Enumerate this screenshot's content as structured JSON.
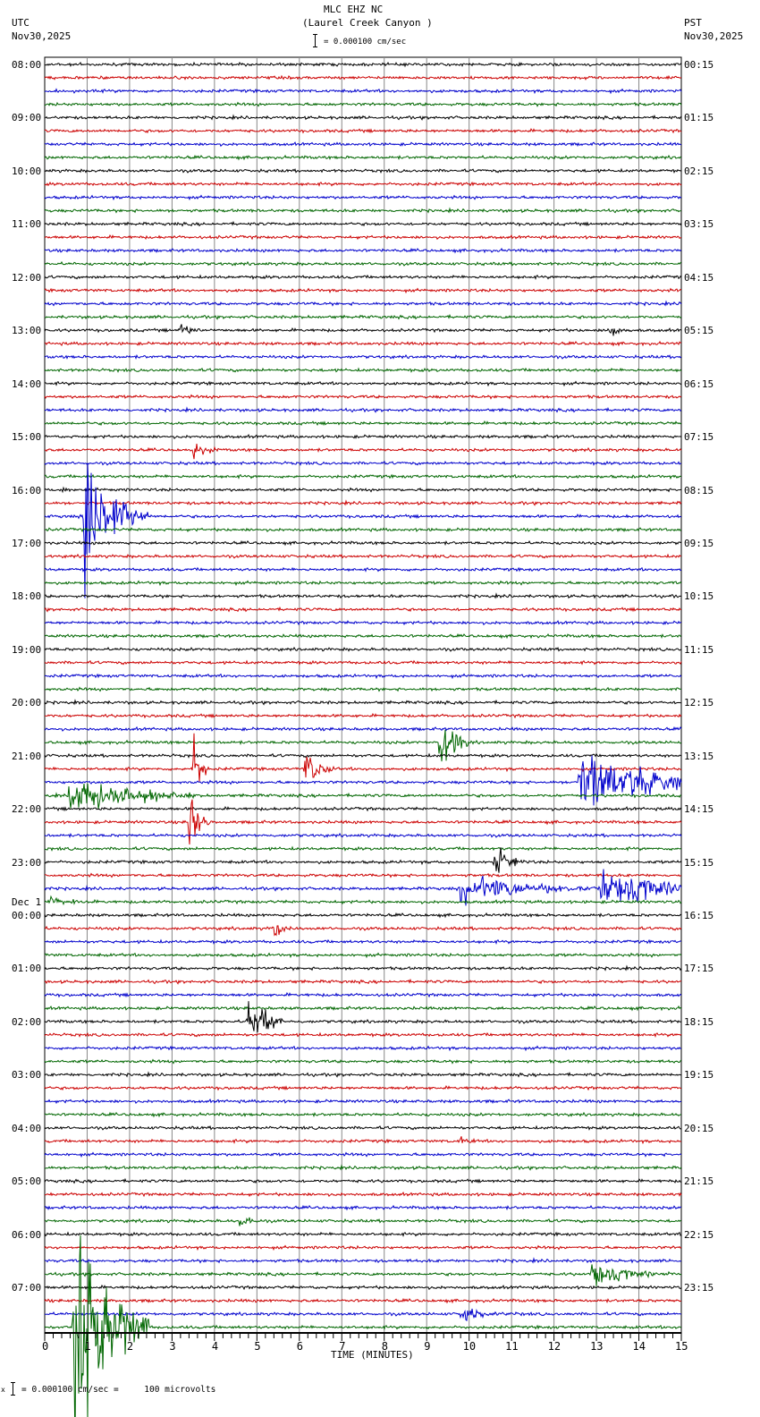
{
  "header": {
    "station": "MLC EHZ NC",
    "location": "(Laurel Creek Canyon )",
    "left_tz": "UTC",
    "left_date": "Nov30,2025",
    "right_tz": "PST",
    "right_date": "Nov30,2025",
    "scale": "= 0.000100 cm/sec"
  },
  "footer": {
    "scale": "= 0.000100 cm/sec =     100 microvolts",
    "prefix": "x"
  },
  "chart_data": {
    "type": "line",
    "title": "MLC EHZ NC (Laurel Creek Canyon )",
    "xlabel": "TIME (MINUTES)",
    "xlim": [
      0,
      15
    ],
    "x_ticks": [
      "0",
      "1",
      "2",
      "3",
      "4",
      "5",
      "6",
      "7",
      "8",
      "9",
      "10",
      "11",
      "12",
      "13",
      "14",
      "15"
    ],
    "traces_per_hour": 4,
    "trace_colors": [
      "#000000",
      "#cc0000",
      "#0000cc",
      "#006600"
    ],
    "utc_labels": [
      "08:00",
      "09:00",
      "10:00",
      "11:00",
      "12:00",
      "13:00",
      "14:00",
      "15:00",
      "16:00",
      "17:00",
      "18:00",
      "19:00",
      "20:00",
      "21:00",
      "22:00",
      "23:00",
      "00:00",
      "01:00",
      "02:00",
      "03:00",
      "04:00",
      "05:00",
      "06:00",
      "07:00"
    ],
    "date_change_label": "Dec 1",
    "pst_labels": [
      "00:15",
      "01:15",
      "02:15",
      "03:15",
      "04:15",
      "05:15",
      "06:15",
      "07:15",
      "08:15",
      "09:15",
      "10:15",
      "11:15",
      "12:15",
      "13:15",
      "14:15",
      "15:15",
      "16:15",
      "17:15",
      "18:15",
      "19:15",
      "20:15",
      "21:15",
      "22:15",
      "23:15"
    ],
    "events": [
      {
        "trace": 20,
        "minute": 3.2,
        "amp": 6,
        "dur": 0.3
      },
      {
        "trace": 20,
        "minute": 13.3,
        "amp": 6,
        "dur": 0.2
      },
      {
        "trace": 29,
        "minute": 3.5,
        "amp": 6,
        "dur": 0.3
      },
      {
        "trace": 32,
        "minute": 0.4,
        "amp": 4,
        "dur": 0.2
      },
      {
        "trace": 34,
        "minute": 0.95,
        "amp": 45,
        "dur": 0.6
      },
      {
        "trace": 51,
        "minute": 9.3,
        "amp": 25,
        "dur": 0.3
      },
      {
        "trace": 53,
        "minute": 6.15,
        "amp": 15,
        "dur": 0.3
      },
      {
        "trace": 53,
        "minute": 3.5,
        "amp": 25,
        "dur": 0.15
      },
      {
        "trace": 54,
        "minute": 12.6,
        "amp": 20,
        "dur": 1.5
      },
      {
        "trace": 54,
        "minute": 13.8,
        "amp": 25,
        "dur": 0.4
      },
      {
        "trace": 55,
        "minute": 0.6,
        "amp": 14,
        "dur": 1.2
      },
      {
        "trace": 57,
        "minute": 3.4,
        "amp": 25,
        "dur": 0.2
      },
      {
        "trace": 60,
        "minute": 10.6,
        "amp": 12,
        "dur": 0.3
      },
      {
        "trace": 62,
        "minute": 9.8,
        "amp": 10,
        "dur": 1.5
      },
      {
        "trace": 62,
        "minute": 13.1,
        "amp": 14,
        "dur": 1.5
      },
      {
        "trace": 63,
        "minute": 0.1,
        "amp": 5,
        "dur": 0.4
      },
      {
        "trace": 65,
        "minute": 5.4,
        "amp": 7,
        "dur": 0.2
      },
      {
        "trace": 72,
        "minute": 4.8,
        "amp": 15,
        "dur": 0.25
      },
      {
        "trace": 72,
        "minute": 5.1,
        "amp": 15,
        "dur": 0.25
      },
      {
        "trace": 81,
        "minute": 9.8,
        "amp": 4,
        "dur": 0.2
      },
      {
        "trace": 87,
        "minute": 4.6,
        "amp": 6,
        "dur": 0.2
      },
      {
        "trace": 91,
        "minute": 12.9,
        "amp": 8,
        "dur": 0.9
      },
      {
        "trace": 94,
        "minute": 9.8,
        "amp": 5,
        "dur": 0.6
      },
      {
        "trace": 95,
        "minute": 0.7,
        "amp": 90,
        "dur": 0.7
      }
    ]
  }
}
